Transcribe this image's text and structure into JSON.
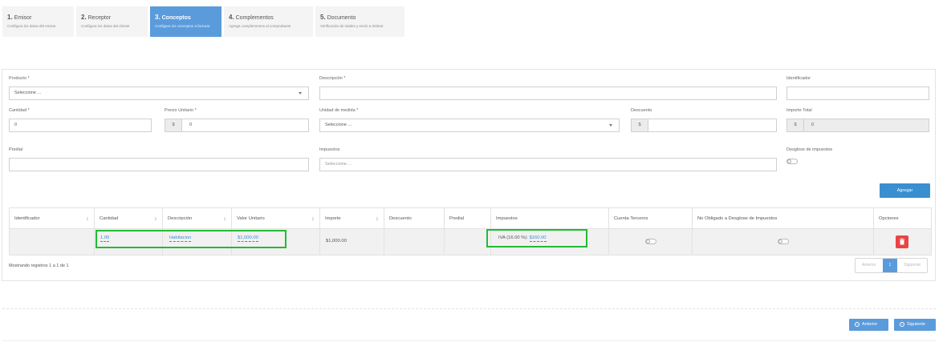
{
  "steps": [
    {
      "num": "1.",
      "title": "Emisor",
      "subtitle": "Configura los datos del emisor"
    },
    {
      "num": "2.",
      "title": "Receptor",
      "subtitle": "Configura los datos del cliente"
    },
    {
      "num": "3.",
      "title": "Conceptos",
      "subtitle": "Configura los conceptos a facturar"
    },
    {
      "num": "4.",
      "title": "Complementos",
      "subtitle": "Agrega complementos al comprobante"
    },
    {
      "num": "5.",
      "title": "Documento",
      "subtitle": "Verificación de totales y envío a timbrar"
    }
  ],
  "form": {
    "producto_label": "Producto *",
    "producto_value": "Seleccione ...",
    "descripcion_label": "Descripción *",
    "identificador_label": "Identificador",
    "cantidad_label": "Cantidad *",
    "cantidad_value": "0",
    "precio_label": "Precio Unitario *",
    "precio_prefix": "$",
    "precio_value": "0",
    "unidad_label": "Unidad de medida *",
    "unidad_value": "Seleccione ...",
    "descuento_label": "Descuento",
    "descuento_prefix": "$",
    "importe_total_label": "Importe Total",
    "importe_total_prefix": "$",
    "importe_total_value": "0",
    "predial_label": "Predial",
    "impuestos_label": "Impuestos",
    "impuestos_placeholder": "Seleccione ...",
    "desglose_label": "Desglose de impuestos",
    "agregar_label": "Agregar"
  },
  "table": {
    "headers": [
      "Identificador",
      "Cantidad",
      "Descripción",
      "Valor Unitario",
      "Importe",
      "Descuento",
      "Predial",
      "Impuestos",
      "Cuenta Terceros",
      "No Obligado a Desglose de Impuestos",
      "Opciones"
    ],
    "rows": [
      {
        "identificador": "",
        "cantidad": "1.00",
        "descripcion": "Habitacion",
        "valor_unitario": "$1,000.00",
        "importe": "$1,000.00",
        "descuento": "",
        "predial": "",
        "impuestos_prefix": "IVA (16.00 %):",
        "impuestos_value": "$160.00"
      }
    ]
  },
  "footer": {
    "info": "Mostrando registros 1 a 1 de 1",
    "prev": "Anterior",
    "page": "1",
    "next": "Siguiente"
  },
  "nav": {
    "anterior": "Anterior",
    "siguiente": "Siguiente"
  },
  "colors": {
    "accent": "#5a9bdc",
    "primary_button": "#3a8fd1",
    "highlight": "#22bb33",
    "danger": "#e84545"
  },
  "icons": [
    "caret-down-icon",
    "trash-icon",
    "arrow-left-circle-icon",
    "arrow-right-circle-icon"
  ]
}
